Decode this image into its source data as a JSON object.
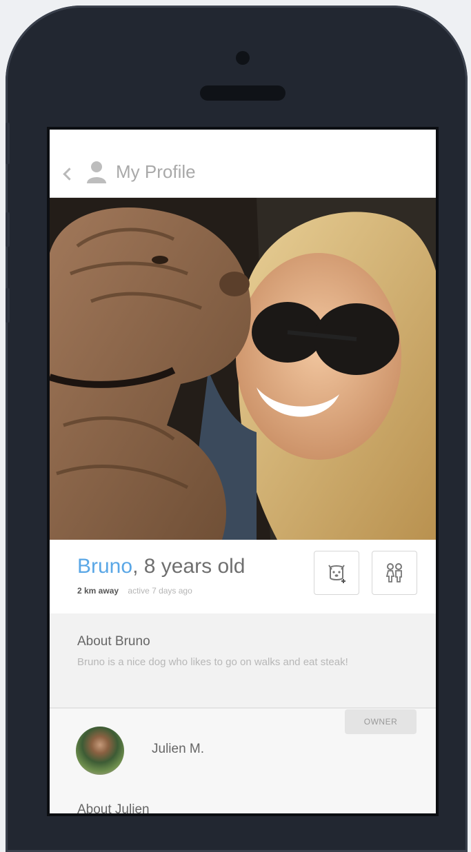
{
  "nav": {
    "back_icon": "chevron-left-icon",
    "user_icon": "user-icon",
    "title": "My Profile"
  },
  "profile": {
    "pet_name": "Bruno",
    "age_text": ", 8 years old",
    "distance": "2 km away",
    "active": "active 7 days ago",
    "add_dog_icon": "dog-plus-icon",
    "couple_icon": "people-icon"
  },
  "about_pet": {
    "title": "About Bruno",
    "body": "Bruno is a nice dog who likes to go on walks and eat steak!"
  },
  "owner": {
    "badge": "OWNER",
    "name": "Julien M.",
    "about_title": "About Julien"
  },
  "colors": {
    "accent": "#5aa7e6",
    "phone_body": "#222731"
  }
}
